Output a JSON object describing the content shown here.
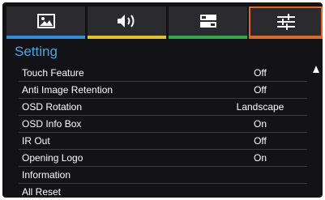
{
  "tabs": [
    {
      "name": "picture",
      "icon": "picture-icon",
      "accent": "#2f8fd8"
    },
    {
      "name": "sound",
      "icon": "speaker-icon",
      "accent": "#e3c12a"
    },
    {
      "name": "display",
      "icon": "display-icon",
      "accent": "#3aa64a"
    },
    {
      "name": "setting",
      "icon": "sliders-icon",
      "accent": "#d96a2a",
      "selected": true
    }
  ],
  "section_title": "Setting",
  "rows": [
    {
      "label": "Touch Feature",
      "value": "Off"
    },
    {
      "label": "Anti Image Retention",
      "value": "Off"
    },
    {
      "label": "OSD Rotation",
      "value": "Landscape"
    },
    {
      "label": "OSD Info Box",
      "value": "On"
    },
    {
      "label": "IR Out",
      "value": "Off"
    },
    {
      "label": "Opening Logo",
      "value": "On"
    },
    {
      "label": "Information",
      "value": ""
    },
    {
      "label": "All Reset",
      "value": ""
    }
  ],
  "scroll_icon": "triangle-up-icon",
  "colors": {
    "background": "#121217",
    "title": "#4aa5e3",
    "text": "#ffffff",
    "divider": "#3a3a40"
  }
}
